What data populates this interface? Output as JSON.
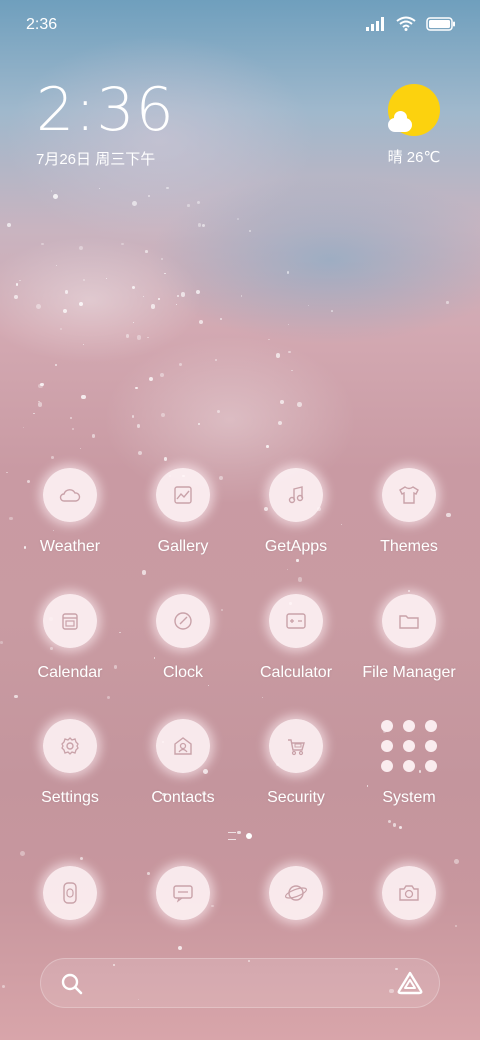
{
  "status_bar": {
    "time": "2:36",
    "icons": [
      "signal-icon",
      "wifi-icon",
      "battery-icon"
    ]
  },
  "clock_widget": {
    "time": "2:36",
    "date": "7月26日 周三下午"
  },
  "weather_widget": {
    "condition_icon": "sun-cloud-icon",
    "text": "晴 26℃"
  },
  "apps": [
    {
      "label": "Weather",
      "icon": "cloud-icon"
    },
    {
      "label": "Gallery",
      "icon": "gallery-icon"
    },
    {
      "label": "GetApps",
      "icon": "music-note-icon"
    },
    {
      "label": "Themes",
      "icon": "shirt-icon"
    },
    {
      "label": "Calendar",
      "icon": "calendar-icon"
    },
    {
      "label": "Clock",
      "icon": "clock-icon"
    },
    {
      "label": "Calculator",
      "icon": "calculator-icon"
    },
    {
      "label": "File Manager",
      "icon": "folder-icon"
    },
    {
      "label": "Settings",
      "icon": "gear-icon"
    },
    {
      "label": "Contacts",
      "icon": "contacts-icon"
    },
    {
      "label": "Security",
      "icon": "security-icon"
    },
    {
      "label": "System",
      "icon": "app-grid-icon"
    }
  ],
  "dock": [
    {
      "icon": "phone-icon"
    },
    {
      "icon": "message-icon"
    },
    {
      "icon": "browser-icon"
    },
    {
      "icon": "camera-icon"
    }
  ],
  "page_indicator": {
    "pages": 2,
    "current": 1
  },
  "search_bar": {
    "left_icon": "search-icon",
    "right_icon": "assistant-icon"
  },
  "colors": {
    "weather_sun": "#fcd20e",
    "icon_bg": "#fff5f7",
    "icon_stroke": "#c9a2a9"
  }
}
